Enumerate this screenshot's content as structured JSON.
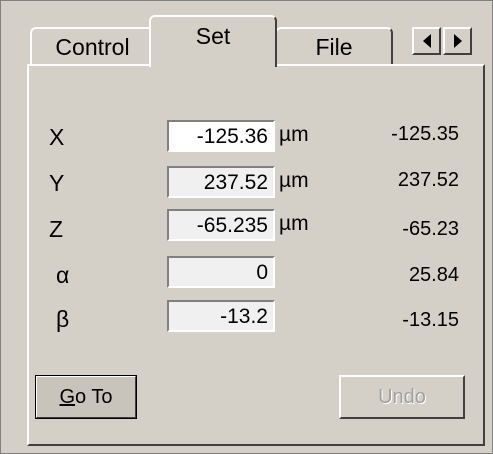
{
  "tabs": [
    {
      "label": "Control"
    },
    {
      "label": "Set"
    },
    {
      "label": "File"
    }
  ],
  "tab_scroll": {
    "left_icon": "arrow-left-icon",
    "right_icon": "arrow-right-icon"
  },
  "rows": [
    {
      "axis": "X",
      "value": "-125.36",
      "unit": "µm",
      "readout": "-125.35"
    },
    {
      "axis": "Y",
      "value": "237.52",
      "unit": "µm",
      "readout": "237.52"
    },
    {
      "axis": "Z",
      "value": "-65.235",
      "unit": "µm",
      "readout": "-65.23"
    },
    {
      "axis": "α",
      "value": "0",
      "unit": "",
      "readout": "25.84"
    },
    {
      "axis": "β",
      "value": "-13.2",
      "unit": "",
      "readout": "-13.15"
    }
  ],
  "buttons": {
    "goto_mnemonic": "G",
    "goto_rest": "o To",
    "undo": "Undo"
  }
}
